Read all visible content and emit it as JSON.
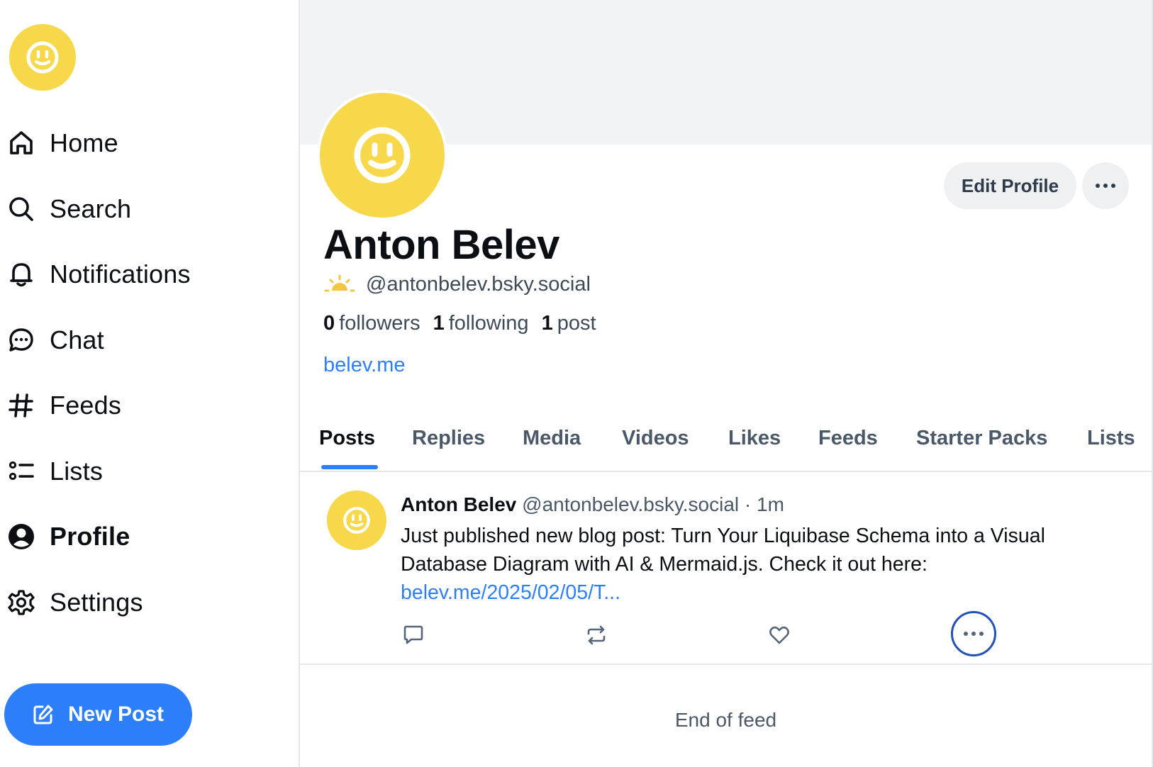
{
  "sidebar": {
    "logo_icon": "smiley-face-icon",
    "items": [
      {
        "label": "Home",
        "icon": "home-icon",
        "active": false
      },
      {
        "label": "Search",
        "icon": "search-icon",
        "active": false
      },
      {
        "label": "Notifications",
        "icon": "bell-icon",
        "active": false
      },
      {
        "label": "Chat",
        "icon": "chat-bubble-icon",
        "active": false
      },
      {
        "label": "Feeds",
        "icon": "hash-icon",
        "active": false
      },
      {
        "label": "Lists",
        "icon": "list-icon",
        "active": false
      },
      {
        "label": "Profile",
        "icon": "user-circle-icon",
        "active": true
      },
      {
        "label": "Settings",
        "icon": "gear-icon",
        "active": false
      }
    ],
    "new_post_label": "New Post",
    "new_post_icon": "compose-icon"
  },
  "profile": {
    "display_name": "Anton Belev",
    "handle": "@antonbelev.bsky.social",
    "handle_icon": "sunrise-icon",
    "followers_count": "0",
    "followers_label": "followers",
    "following_count": "1",
    "following_label": "following",
    "posts_count": "1",
    "posts_label": "post",
    "website": "belev.me",
    "edit_label": "Edit Profile",
    "more_icon": "ellipsis-icon"
  },
  "tabs": [
    {
      "label": "Posts",
      "active": true
    },
    {
      "label": "Replies",
      "active": false
    },
    {
      "label": "Media",
      "active": false
    },
    {
      "label": "Videos",
      "active": false
    },
    {
      "label": "Likes",
      "active": false
    },
    {
      "label": "Feeds",
      "active": false
    },
    {
      "label": "Starter Packs",
      "active": false
    },
    {
      "label": "Lists",
      "active": false
    }
  ],
  "post": {
    "author": "Anton Belev",
    "handle": "@antonbelev.bsky.social",
    "separator": "·",
    "time": "1m",
    "text": "Just published new blog post: Turn Your Liquibase Schema into a Visual Database Diagram with AI & Mermaid.js. Check it out here:",
    "link": "belev.me/2025/02/05/T...",
    "actions": [
      "reply-icon",
      "repost-icon",
      "like-icon",
      "ellipsis-icon"
    ]
  },
  "feed_end_text": "End of feed",
  "colors": {
    "accent": "#2d7ff9",
    "avatar": "#f6d84a",
    "banner": "#f2f3f5"
  }
}
